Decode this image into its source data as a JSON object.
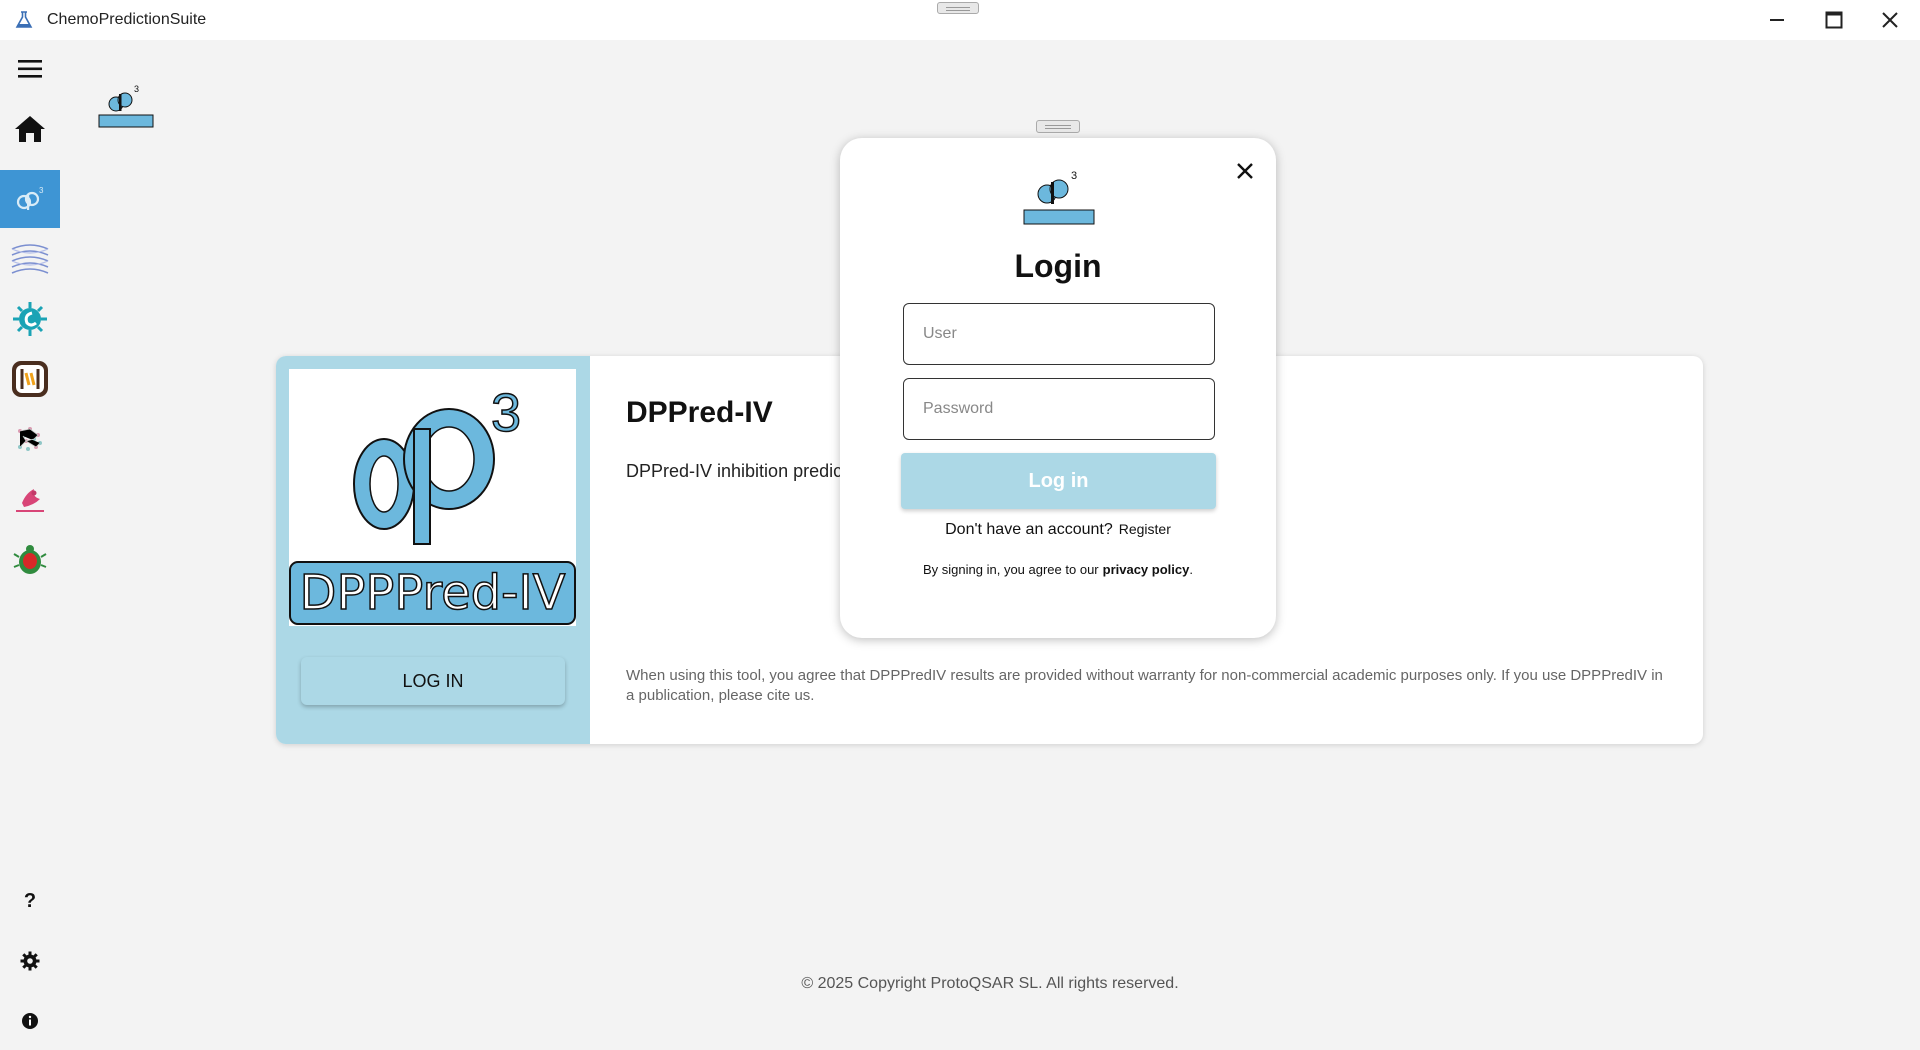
{
  "window": {
    "title": "ChemoPredictionSuite",
    "minimize_icon": "minimize-icon",
    "maximize_icon": "maximize-icon",
    "close_icon": "close-icon"
  },
  "sidebar": {
    "items": [
      {
        "icon": "menu-icon"
      },
      {
        "icon": "home-icon"
      },
      {
        "icon": "dppred-logo-icon",
        "active": true
      },
      {
        "icon": "layers-app-icon"
      },
      {
        "icon": "virus-app-icon"
      },
      {
        "icon": "bracket-app-icon"
      },
      {
        "icon": "dots-app-icon"
      },
      {
        "icon": "pink-bird-app-icon"
      },
      {
        "icon": "bug-app-icon"
      }
    ],
    "bottom": [
      {
        "icon": "help-icon",
        "label": "?"
      },
      {
        "icon": "gear-icon"
      },
      {
        "icon": "info-icon"
      }
    ]
  },
  "card": {
    "title": "DPPred-IV",
    "description": "DPPred-IV inhibition predict",
    "logo_text": "DPPPred-IV",
    "login_button": "LOG IN",
    "note": "When using this tool, you agree that DPPPredIV results are provided without warranty for non-commercial academic purposes only. If you use DPPPredIV in a publication, please cite us."
  },
  "login_modal": {
    "title": "Login",
    "user_placeholder": "User",
    "password_placeholder": "Password",
    "login_button": "Log in",
    "no_account_text": "Don't have an account?",
    "register_link": "Register",
    "policy_text": "By signing in, you agree to our",
    "policy_link": "privacy policy",
    "policy_end": "."
  },
  "footer": {
    "copyright": "© 2025 Copyright ProtoQSAR SL. All rights reserved."
  },
  "colors": {
    "accent": "#acd8e6",
    "active_sidebar": "#3e95d4",
    "logo_blue": "#6cb8dd"
  }
}
